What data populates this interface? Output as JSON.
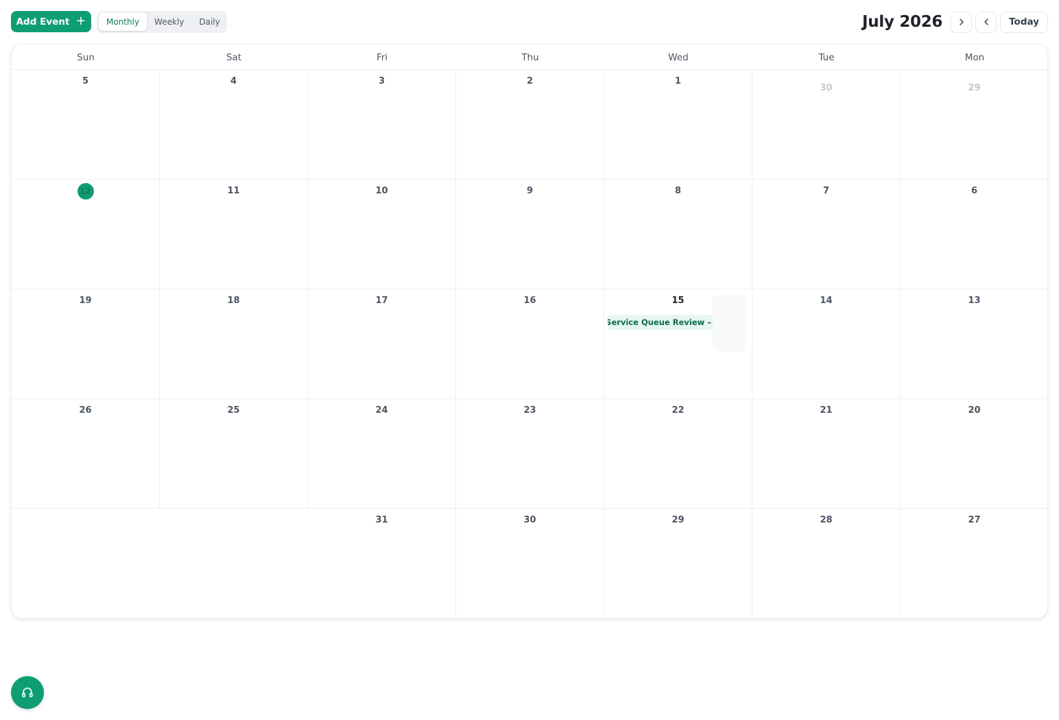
{
  "toolbar": {
    "add_event_label": "Add Event",
    "views": [
      "Monthly",
      "Weekly",
      "Daily"
    ],
    "active_view": "Monthly",
    "month_title": "July 2026",
    "today_label": "Today"
  },
  "calendar": {
    "weekdays": [
      "Sun",
      "Sat",
      "Fri",
      "Thu",
      "Wed",
      "Tue",
      "Mon"
    ],
    "weeks": [
      [
        {
          "d": "5"
        },
        {
          "d": "4"
        },
        {
          "d": "3"
        },
        {
          "d": "2"
        },
        {
          "d": "1"
        },
        {
          "d": "30",
          "muted": true
        },
        {
          "d": "29",
          "muted": true
        }
      ],
      [
        {
          "d": "12",
          "today": true
        },
        {
          "d": "11"
        },
        {
          "d": "10"
        },
        {
          "d": "9"
        },
        {
          "d": "8"
        },
        {
          "d": "7"
        },
        {
          "d": "6"
        }
      ],
      [
        {
          "d": "19"
        },
        {
          "d": "18"
        },
        {
          "d": "17"
        },
        {
          "d": "16"
        },
        {
          "d": "15",
          "strong": true,
          "event": "Daily Service Queue Review –"
        },
        {
          "d": "14"
        },
        {
          "d": "13"
        }
      ],
      [
        {
          "d": "26"
        },
        {
          "d": "25"
        },
        {
          "d": "24"
        },
        {
          "d": "23"
        },
        {
          "d": "22"
        },
        {
          "d": "21"
        },
        {
          "d": "20"
        }
      ],
      [
        {
          "d": "",
          "empty": true
        },
        {
          "d": "",
          "empty": true
        },
        {
          "d": "31"
        },
        {
          "d": "30"
        },
        {
          "d": "29"
        },
        {
          "d": "28"
        },
        {
          "d": "27"
        }
      ]
    ]
  },
  "colors": {
    "accent": "#0f9d74",
    "event_bg": "#e7f6ef",
    "event_text": "#0b6b4c"
  },
  "support": {
    "icon": "headset-icon"
  }
}
